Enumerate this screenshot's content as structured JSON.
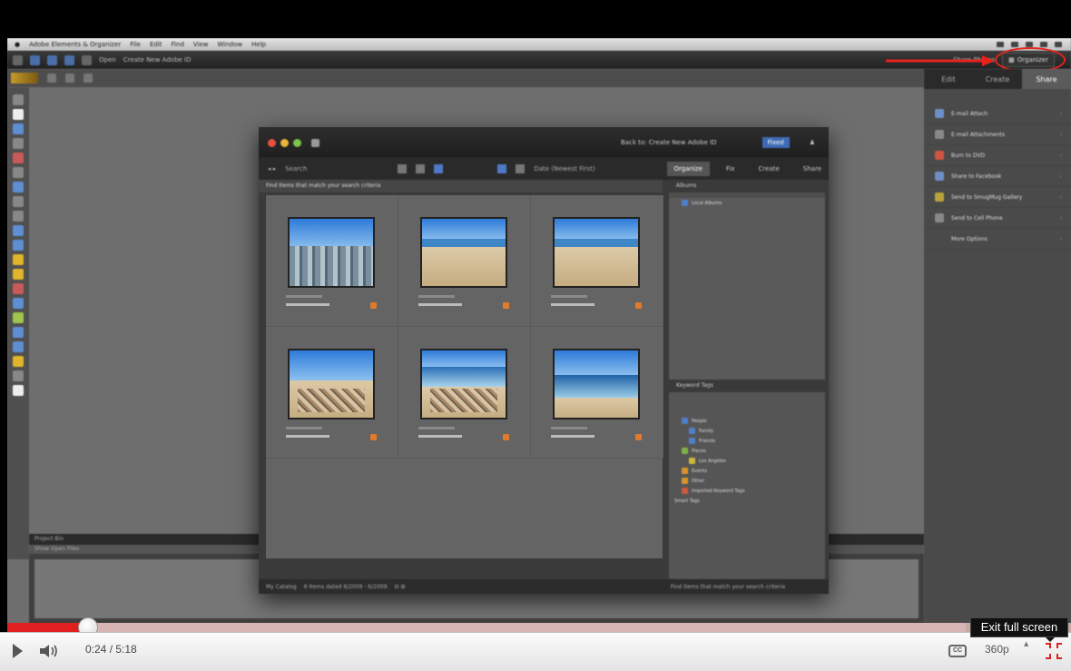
{
  "menubar": {
    "app_title": "Adobe Elements & Organizer",
    "items": [
      "File",
      "Edit",
      "Find",
      "View",
      "Window",
      "Help"
    ]
  },
  "topbar": {
    "label": "Open",
    "create_label": "Create New Adobe ID",
    "right_link": "Share Photos",
    "organizer_button": "Organizer"
  },
  "right_panel": {
    "tabs": [
      "Edit",
      "Create",
      "Share"
    ],
    "items": [
      "E-mail Attach",
      "E-mail Attachments",
      "Burn to DVD",
      "Share to Facebook",
      "Send to SmugMug Gallery",
      "Send to Cell Phone",
      "More Options"
    ]
  },
  "organizer": {
    "title_text": "Back to: Create New Adobe ID",
    "fix_btn": "Fixed",
    "toolbar_search": "Search",
    "sort_select": "Date (Newest First)",
    "tabs": [
      "Organize",
      "Fix",
      "Create",
      "Share"
    ],
    "info_bar": "Find Items that match your search criteria",
    "albums_header": "Albums",
    "album_item": "Local Albums",
    "tags_header": "Keyword Tags",
    "tags": [
      "People",
      "Family",
      "Friends",
      "Places",
      "Los Angeles",
      "Events",
      "Other",
      "Imported Keyword Tags",
      "Smart Tags"
    ],
    "status_left": "My Catalog",
    "status_mid": "6 Items dated 6/2009 - 6/2009",
    "status_right": "Find items that match your search criteria"
  },
  "bin": {
    "header": "Project Bin",
    "subheader": "Show Open Files"
  },
  "player": {
    "time": "0:24 / 5:18",
    "quality": "360p",
    "tooltip": "Exit full screen",
    "progress": 0.076,
    "colors": {
      "progress_fill": "#e02020",
      "annotation": "#e8231c"
    }
  }
}
